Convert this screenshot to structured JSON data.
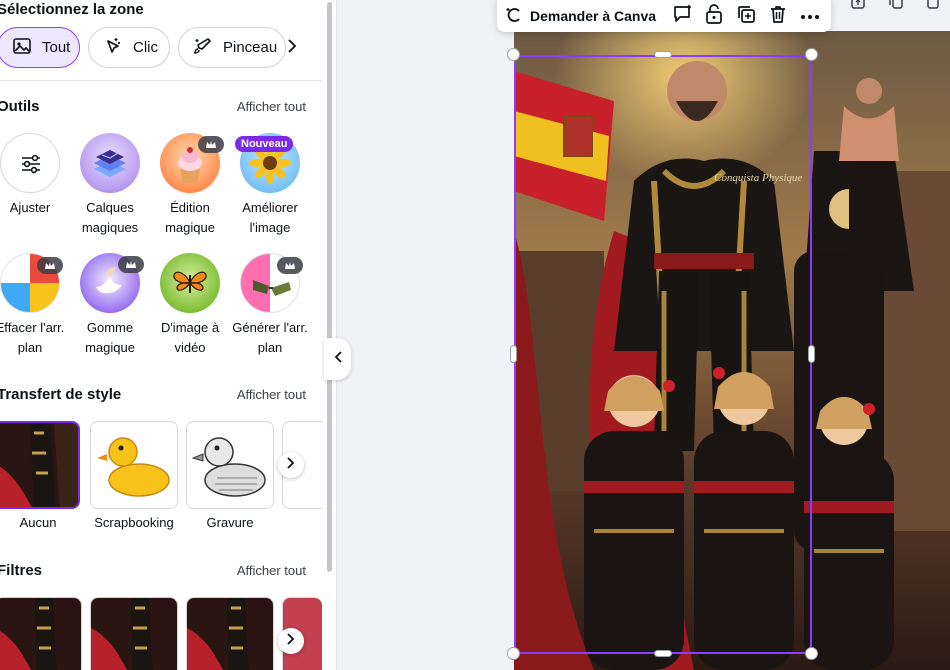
{
  "panel": {
    "zone_title": "Sélectionnez la zone",
    "chips": [
      {
        "label": "Tout",
        "icon": "image-icon",
        "active": true
      },
      {
        "label": "Clic",
        "icon": "magic-click-icon",
        "active": false
      },
      {
        "label": "Pinceau",
        "icon": "brush-icon",
        "active": false
      }
    ],
    "tools_section": {
      "title": "Outils",
      "see_all": "Afficher tout",
      "items": [
        {
          "label": "Ajuster",
          "icon": "sliders-icon"
        },
        {
          "label": "Calques magiques",
          "icon": "magic-layers-icon"
        },
        {
          "label": "Édition magique",
          "icon": "cupcake-icon",
          "premium": true
        },
        {
          "label": "Améliorer l'image",
          "icon": "sunflower-icon",
          "badge": "Nouveau"
        },
        {
          "label": "Effacer l'arr. plan",
          "icon": "beach-ball-icon",
          "premium": true
        },
        {
          "label": "Gomme magique",
          "icon": "dove-icon",
          "premium": true
        },
        {
          "label": "D'image à vidéo",
          "icon": "butterfly-icon"
        },
        {
          "label": "Générer l'arr. plan",
          "icon": "sunglasses-icon",
          "premium": true
        }
      ]
    },
    "style_section": {
      "title": "Transfert de style",
      "see_all": "Afficher tout",
      "items": [
        {
          "label": "Aucun"
        },
        {
          "label": "Scrapbooking"
        },
        {
          "label": "Gravure"
        }
      ]
    },
    "filters_section": {
      "title": "Filtres",
      "see_all": "Afficher tout"
    }
  },
  "context_toolbar": {
    "ask_label": "Demander à Canva",
    "icons": [
      "comment-add-icon",
      "lock-icon",
      "duplicate-icon",
      "trash-icon",
      "more-icon"
    ]
  },
  "canvas": {
    "image_text": "Conquista Physique"
  },
  "colors": {
    "accent": "#8b3dff",
    "badge": "#7d2ae8"
  }
}
